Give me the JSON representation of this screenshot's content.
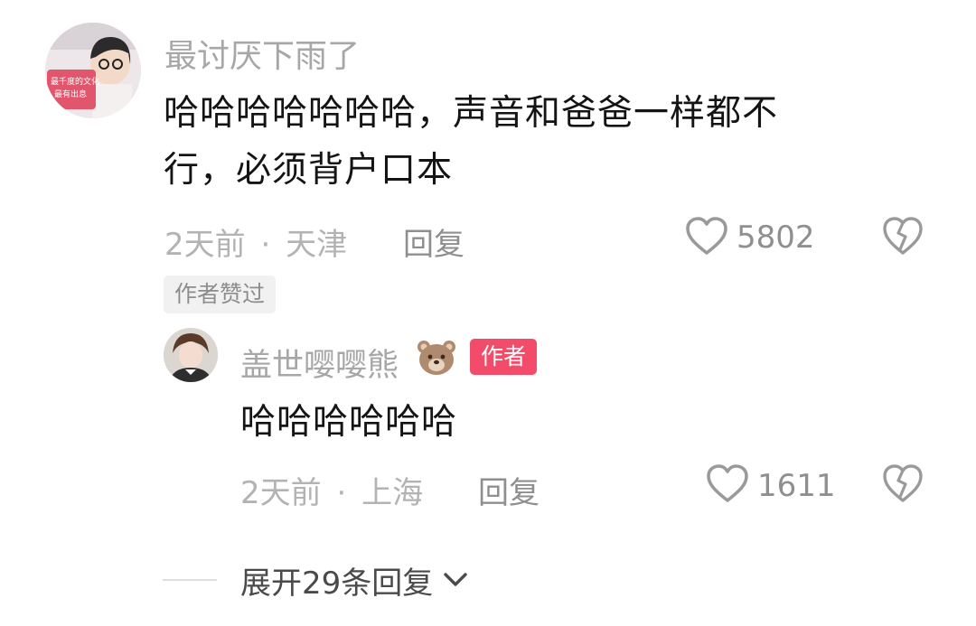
{
  "comment": {
    "username": "最讨厌下雨了",
    "text_line1": "哈哈哈哈哈哈哈，声音和爸爸一样都不",
    "text_line2": "行，必须背户口本",
    "time": "2天前",
    "location": "天津",
    "separator": "·",
    "reply_label": "回复",
    "likes": "5802",
    "author_liked_badge": "作者赞过",
    "avatar_text_1": "最千度的文化",
    "avatar_text_2": "最有出息"
  },
  "reply": {
    "username": "盖世嘤嘤熊",
    "author_badge": "作者",
    "text": "哈哈哈哈哈哈",
    "time": "2天前",
    "location": "上海",
    "separator": "·",
    "reply_label": "回复",
    "likes": "1611"
  },
  "expand": {
    "label": "展开29条回复"
  },
  "colors": {
    "author_badge_bg": "#f24c6a",
    "meta_text": "#b3b3b3",
    "icon": "#9a9a9a"
  },
  "icons": [
    "heart-outline-icon",
    "broken-heart-icon",
    "chevron-down-icon",
    "bear-emoji-icon"
  ]
}
